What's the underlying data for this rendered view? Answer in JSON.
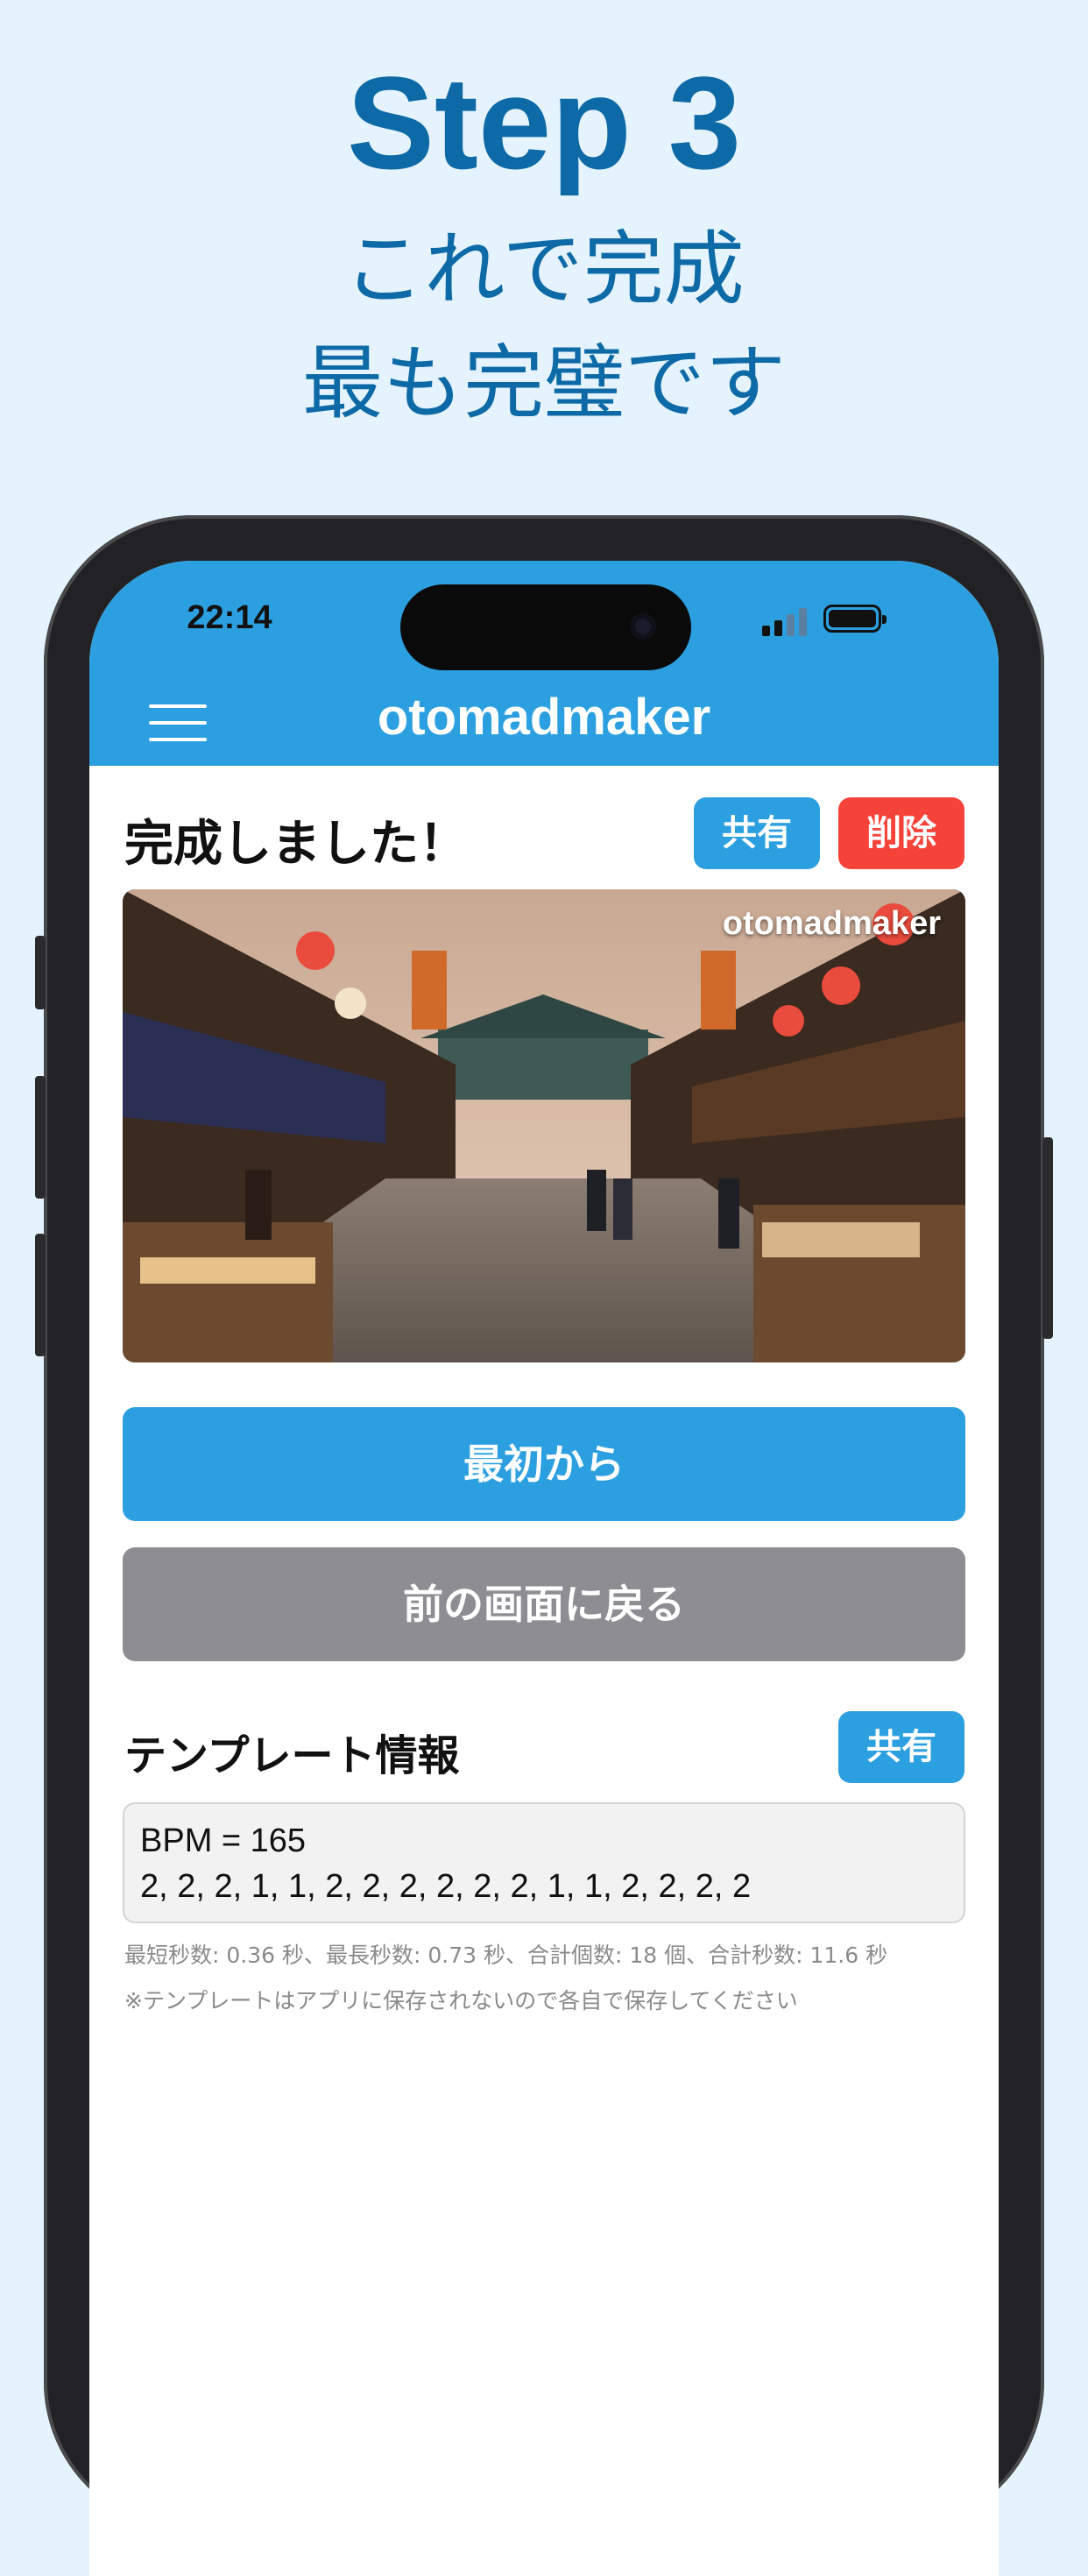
{
  "promo": {
    "step": "Step 3",
    "line1": "これで完成",
    "line2": "最も完璧です"
  },
  "status_bar": {
    "time": "22:14"
  },
  "header": {
    "app_title": "otomadmaker",
    "menu_icon": "hamburger-menu-icon"
  },
  "result": {
    "title": "完成しました！",
    "share_label": "共有",
    "delete_label": "削除",
    "watermark": "otomadmaker"
  },
  "actions": {
    "restart_label": "最初から",
    "back_label": "前の画面に戻る"
  },
  "template": {
    "title": "テンプレート情報",
    "share_label": "共有",
    "bpm_line": "BPM = 165",
    "pattern_line": "2, 2, 2, 1, 1, 2, 2, 2, 2, 2, 2, 1, 1, 2, 2, 2, 2",
    "stats": "最短秒数: 0.36 秒、最長秒数: 0.73 秒、合計個数: 18 個、合計秒数: 11.6 秒",
    "note": "※テンプレートはアプリに保存されないので各自で保存してください"
  },
  "colors": {
    "accent": "#2c9fe0",
    "danger": "#f6433a",
    "secondary": "#8e8d93",
    "promo_text": "#0e6aa6",
    "promo_bg": "#e4f3fd"
  }
}
